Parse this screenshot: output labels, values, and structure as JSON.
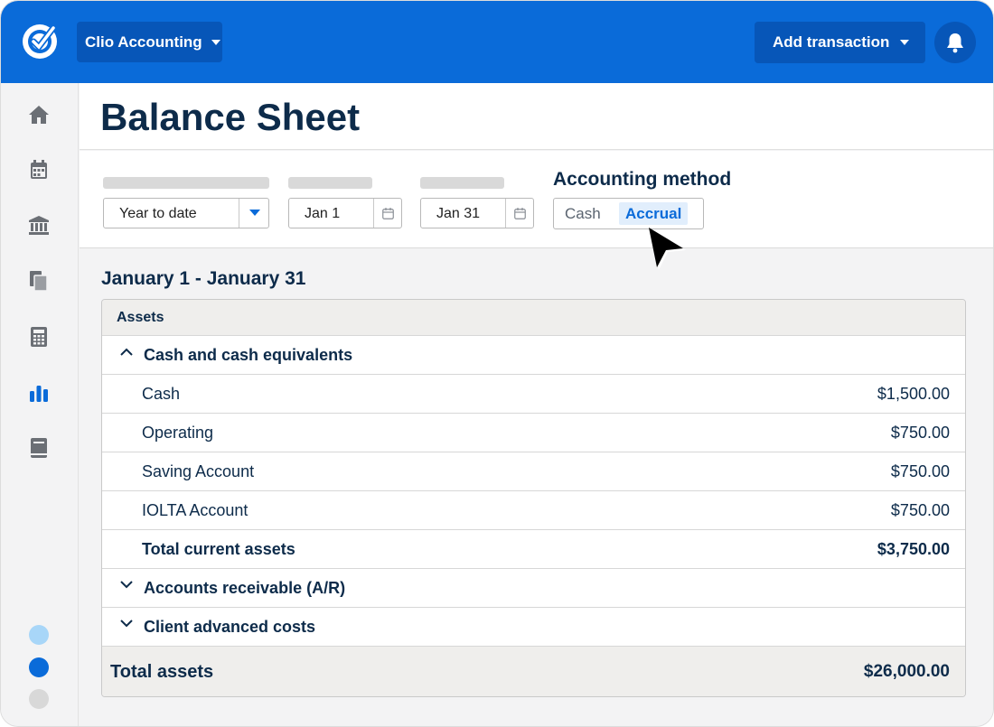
{
  "header": {
    "firm_label": "Clio Accounting",
    "add_label": "Add transaction"
  },
  "page": {
    "title": "Balance Sheet"
  },
  "filters": {
    "range_value": "Year to date",
    "start_date": "Jan 1",
    "end_date": "Jan 31",
    "method_label": "Accounting method",
    "method_options": [
      "Cash",
      "Accrual"
    ],
    "method_selected": "Accrual"
  },
  "report": {
    "period": "January 1 - January 31",
    "section_header": "Assets",
    "groups": [
      {
        "label": "Cash and cash equivalents",
        "expanded": true,
        "items": [
          {
            "label": "Cash",
            "amount": "$1,500.00"
          },
          {
            "label": "Operating",
            "amount": "$750.00"
          },
          {
            "label": "Saving Account",
            "amount": "$750.00"
          },
          {
            "label": "IOLTA Account",
            "amount": "$750.00"
          }
        ],
        "total_label": "Total current assets",
        "total_amount": "$3,750.00"
      },
      {
        "label": "Accounts receivable (A/R)",
        "expanded": false
      },
      {
        "label": "Client advanced costs",
        "expanded": false
      }
    ],
    "grand_total_label": "Total assets",
    "grand_total_amount": "$26,000.00"
  },
  "sidebar": {
    "icons": [
      "home-icon",
      "calendar-icon",
      "bank-icon",
      "documents-icon",
      "calculator-icon",
      "reports-icon",
      "book-icon"
    ],
    "active": "reports-icon"
  },
  "colors": {
    "brand": "#0a6bd9",
    "brand_dark": "#0756b8",
    "text_dark": "#0d2b4a"
  }
}
